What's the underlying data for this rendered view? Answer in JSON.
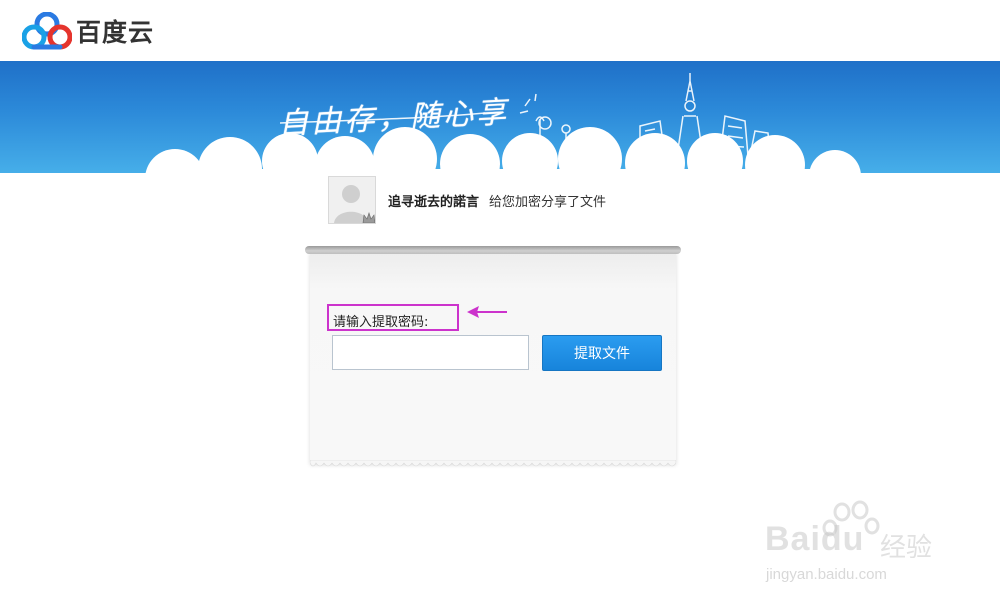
{
  "header": {
    "brand": "百度云"
  },
  "banner": {
    "slogan": "自由存，随心享"
  },
  "share": {
    "user_name": "追寻逝去的諾言",
    "message": "给您加密分享了文件"
  },
  "form": {
    "prompt_label": "请输入提取密码:",
    "code_value": "",
    "submit_label": "提取文件"
  },
  "watermark": {
    "logo_text": "Baidu",
    "logo_suffix": "经验",
    "url": "jingyan.baidu.com"
  },
  "colors": {
    "accent": "#1b8ae0",
    "annotation": "#cc33cc",
    "banner_top": "#1f70c8",
    "banner_bottom": "#46aee9"
  }
}
